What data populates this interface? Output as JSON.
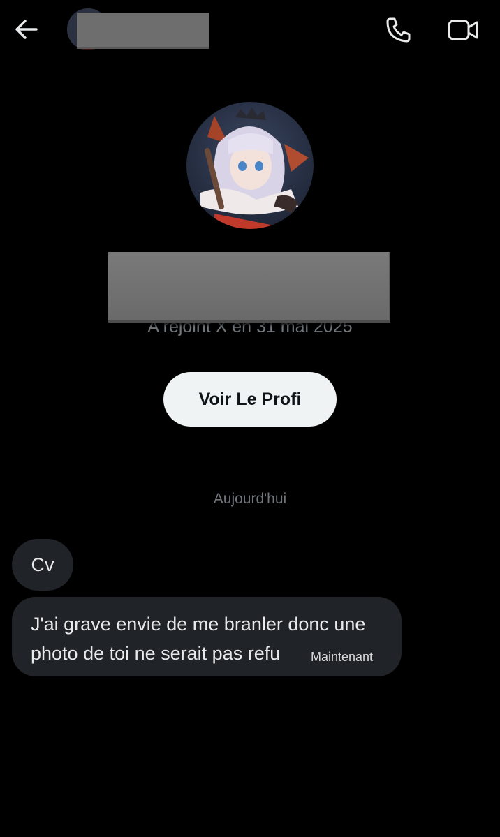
{
  "header": {
    "back_icon": "arrow-left-icon",
    "call_icon": "phone-icon",
    "video_icon": "video-camera-icon"
  },
  "profile": {
    "joined_text": "A rejoint X en 31 mai 2025",
    "view_profile_label": "Voir Le Profi"
  },
  "conversation": {
    "date_separator": "Aujourd'hui",
    "messages": [
      {
        "lines": [
          "Cv"
        ]
      },
      {
        "lines": [
          "J'ai grave envie de me branler donc une",
          "photo de toi ne serait pas refu"
        ],
        "time": "Maintenant"
      }
    ]
  },
  "colors": {
    "background": "#000000",
    "bubble": "#202327",
    "secondary_text": "#71767b",
    "button_bg": "#eff3f4",
    "redaction": "#6e6e6e"
  }
}
